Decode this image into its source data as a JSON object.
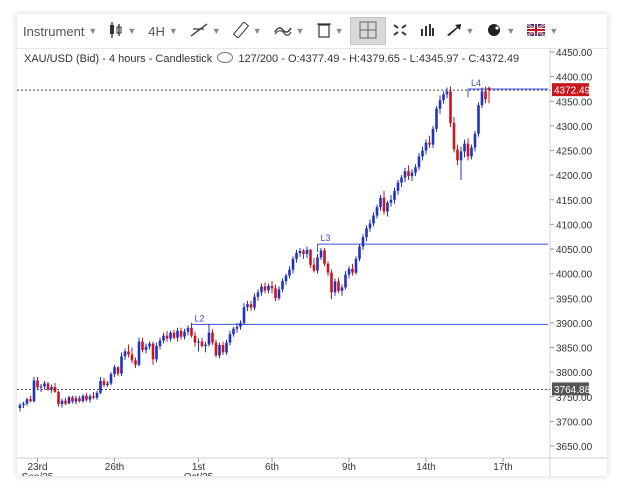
{
  "toolbar": {
    "instrument_label": "Instrument",
    "timeframe_label": "4H",
    "icons": [
      "candlestick-icon",
      "line-tool-icon",
      "ruler-icon",
      "indicator-icon",
      "trash-icon",
      "crosshair-icon",
      "fullscreen-icon",
      "volume-bars-icon",
      "arrow-tool-icon",
      "color-palette-icon",
      "flag-uk-icon"
    ]
  },
  "info_bar": {
    "symbol": "XAU/USD (Bid) - 4 hours - Candlestick",
    "count": "127/200",
    "ohlc": "- O:4377.49 - H:4379.65 - L:4345.97 - C:4372.49"
  },
  "colors": {
    "up": "#2233bb",
    "down": "#c8161d",
    "level_line": "#3b4fd9",
    "price_label_bg": "#c8161d",
    "marker_label_bg": "#555555"
  },
  "chart_data": {
    "type": "candlestick",
    "ylim": [
      3630,
      4460
    ],
    "y_ticks": [
      "4450.00",
      "4400.00",
      "4350.00",
      "4300.00",
      "4250.00",
      "4200.00",
      "4150.00",
      "4100.00",
      "4050.00",
      "4000.00",
      "3950.00",
      "3900.00",
      "3850.00",
      "3800.00",
      "3750.00",
      "3700.00",
      "3650.00"
    ],
    "y_tick_values": [
      4450,
      4400,
      4350,
      4300,
      4250,
      4200,
      4150,
      4100,
      4050,
      4000,
      3950,
      3900,
      3850,
      3800,
      3750,
      3700,
      3650
    ],
    "x_ticks": [
      {
        "index": 5,
        "line1": "23rd",
        "line2": "Sep/25"
      },
      {
        "index": 27,
        "line1": "26th",
        "line2": ""
      },
      {
        "index": 51,
        "line1": "1st",
        "line2": "Oct/25"
      },
      {
        "index": 72,
        "line1": "6th",
        "line2": ""
      },
      {
        "index": 94,
        "line1": "9th",
        "line2": ""
      },
      {
        "index": 116,
        "line1": "14th",
        "line2": ""
      },
      {
        "index": 138,
        "line1": "17th",
        "line2": ""
      }
    ],
    "current_price": 4372.49,
    "current_price_label": "4372.49",
    "marker_price": 3764.88,
    "marker_price_label": "3764.88",
    "levels": [
      {
        "label": "L2",
        "price": 3897,
        "start_index": 49
      },
      {
        "label": "L3",
        "price": 4060,
        "start_index": 85
      },
      {
        "label": "L4",
        "price": 4375,
        "start_index": 128
      }
    ],
    "ohlc": [
      [
        3727,
        3737,
        3720,
        3733
      ],
      [
        3733,
        3740,
        3727,
        3736
      ],
      [
        3736,
        3748,
        3732,
        3745
      ],
      [
        3745,
        3752,
        3738,
        3741
      ],
      [
        3741,
        3790,
        3738,
        3783
      ],
      [
        3783,
        3790,
        3766,
        3769
      ],
      [
        3769,
        3776,
        3760,
        3771
      ],
      [
        3771,
        3782,
        3765,
        3777
      ],
      [
        3777,
        3780,
        3762,
        3765
      ],
      [
        3765,
        3775,
        3758,
        3770
      ],
      [
        3770,
        3778,
        3758,
        3760
      ],
      [
        3760,
        3762,
        3730,
        3735
      ],
      [
        3735,
        3746,
        3728,
        3742
      ],
      [
        3742,
        3748,
        3733,
        3736
      ],
      [
        3736,
        3752,
        3735,
        3749
      ],
      [
        3749,
        3752,
        3736,
        3740
      ],
      [
        3740,
        3752,
        3735,
        3747
      ],
      [
        3747,
        3752,
        3738,
        3741
      ],
      [
        3741,
        3755,
        3738,
        3752
      ],
      [
        3752,
        3758,
        3740,
        3744
      ],
      [
        3744,
        3755,
        3738,
        3751
      ],
      [
        3751,
        3760,
        3745,
        3748
      ],
      [
        3748,
        3762,
        3744,
        3758
      ],
      [
        3758,
        3790,
        3755,
        3782
      ],
      [
        3782,
        3788,
        3770,
        3774
      ],
      [
        3774,
        3782,
        3770,
        3777
      ],
      [
        3777,
        3800,
        3773,
        3796
      ],
      [
        3796,
        3815,
        3790,
        3810
      ],
      [
        3810,
        3812,
        3792,
        3797
      ],
      [
        3797,
        3840,
        3792,
        3832
      ],
      [
        3832,
        3848,
        3825,
        3842
      ],
      [
        3842,
        3856,
        3830,
        3836
      ],
      [
        3836,
        3850,
        3818,
        3824
      ],
      [
        3824,
        3830,
        3808,
        3815
      ],
      [
        3815,
        3870,
        3812,
        3862
      ],
      [
        3862,
        3870,
        3840,
        3845
      ],
      [
        3845,
        3858,
        3838,
        3852
      ],
      [
        3852,
        3862,
        3846,
        3858
      ],
      [
        3858,
        3862,
        3815,
        3826
      ],
      [
        3826,
        3860,
        3820,
        3853
      ],
      [
        3853,
        3870,
        3846,
        3864
      ],
      [
        3864,
        3880,
        3858,
        3874
      ],
      [
        3874,
        3884,
        3862,
        3868
      ],
      [
        3868,
        3884,
        3862,
        3880
      ],
      [
        3880,
        3886,
        3866,
        3870
      ],
      [
        3870,
        3890,
        3862,
        3884
      ],
      [
        3884,
        3890,
        3866,
        3872
      ],
      [
        3872,
        3888,
        3866,
        3882
      ],
      [
        3882,
        3895,
        3875,
        3890
      ],
      [
        3890,
        3900,
        3870,
        3874
      ],
      [
        3874,
        3882,
        3852,
        3860
      ],
      [
        3860,
        3868,
        3842,
        3862
      ],
      [
        3862,
        3870,
        3850,
        3853
      ],
      [
        3853,
        3862,
        3840,
        3856
      ],
      [
        3856,
        3898,
        3852,
        3880
      ],
      [
        3880,
        3887,
        3855,
        3860
      ],
      [
        3860,
        3866,
        3830,
        3834
      ],
      [
        3834,
        3860,
        3828,
        3855
      ],
      [
        3855,
        3862,
        3835,
        3840
      ],
      [
        3840,
        3866,
        3835,
        3860
      ],
      [
        3860,
        3884,
        3854,
        3877
      ],
      [
        3877,
        3892,
        3872,
        3888
      ],
      [
        3888,
        3900,
        3880,
        3892
      ],
      [
        3892,
        3905,
        3886,
        3900
      ],
      [
        3900,
        3940,
        3896,
        3932
      ],
      [
        3932,
        3945,
        3924,
        3938
      ],
      [
        3938,
        3945,
        3925,
        3931
      ],
      [
        3931,
        3960,
        3926,
        3953
      ],
      [
        3953,
        3968,
        3945,
        3962
      ],
      [
        3962,
        3980,
        3955,
        3974
      ],
      [
        3974,
        3982,
        3960,
        3966
      ],
      [
        3966,
        3980,
        3960,
        3975
      ],
      [
        3975,
        3985,
        3960,
        3970
      ],
      [
        3970,
        3978,
        3944,
        3950
      ],
      [
        3950,
        3974,
        3946,
        3968
      ],
      [
        3968,
        3990,
        3962,
        3985
      ],
      [
        3985,
        4000,
        3978,
        3996
      ],
      [
        3996,
        4015,
        3990,
        4008
      ],
      [
        4008,
        4035,
        4000,
        4030
      ],
      [
        4030,
        4048,
        4022,
        4042
      ],
      [
        4042,
        4052,
        4034,
        4046
      ],
      [
        4046,
        4050,
        4030,
        4040
      ],
      [
        4040,
        4055,
        4032,
        4048
      ],
      [
        4048,
        4050,
        4012,
        4018
      ],
      [
        4018,
        4032,
        4002,
        4006
      ],
      [
        4006,
        4040,
        4000,
        4033
      ],
      [
        4033,
        4052,
        4028,
        4047
      ],
      [
        4047,
        4052,
        4015,
        4020
      ],
      [
        4020,
        4025,
        3995,
        4002
      ],
      [
        4002,
        4008,
        3948,
        3962
      ],
      [
        3962,
        3990,
        3955,
        3984
      ],
      [
        3984,
        3992,
        3960,
        3965
      ],
      [
        3965,
        3978,
        3955,
        3972
      ],
      [
        3972,
        4005,
        3968,
        3998
      ],
      [
        3998,
        4015,
        3990,
        4010
      ],
      [
        4010,
        4020,
        3996,
        4002
      ],
      [
        4002,
        4035,
        3998,
        4030
      ],
      [
        4030,
        4060,
        4025,
        4055
      ],
      [
        4055,
        4080,
        4048,
        4074
      ],
      [
        4074,
        4098,
        4066,
        4092
      ],
      [
        4092,
        4110,
        4085,
        4102
      ],
      [
        4102,
        4125,
        4096,
        4118
      ],
      [
        4118,
        4140,
        4112,
        4135
      ],
      [
        4135,
        4160,
        4128,
        4154
      ],
      [
        4154,
        4168,
        4120,
        4126
      ],
      [
        4126,
        4148,
        4116,
        4144
      ],
      [
        4144,
        4160,
        4136,
        4150
      ],
      [
        4150,
        4175,
        4142,
        4168
      ],
      [
        4168,
        4190,
        4160,
        4185
      ],
      [
        4185,
        4200,
        4176,
        4195
      ],
      [
        4195,
        4215,
        4186,
        4208
      ],
      [
        4208,
        4220,
        4190,
        4198
      ],
      [
        4198,
        4212,
        4188,
        4205
      ],
      [
        4205,
        4222,
        4198,
        4216
      ],
      [
        4216,
        4245,
        4210,
        4238
      ],
      [
        4238,
        4258,
        4230,
        4250
      ],
      [
        4250,
        4272,
        4242,
        4266
      ],
      [
        4266,
        4280,
        4255,
        4262
      ],
      [
        4262,
        4300,
        4255,
        4294
      ],
      [
        4294,
        4340,
        4288,
        4335
      ],
      [
        4335,
        4362,
        4325,
        4352
      ],
      [
        4352,
        4370,
        4345,
        4364
      ],
      [
        4364,
        4378,
        4356,
        4370
      ],
      [
        4370,
        4380,
        4298,
        4306
      ],
      [
        4306,
        4318,
        4246,
        4252
      ],
      [
        4252,
        4262,
        4220,
        4230
      ],
      [
        4230,
        4258,
        4190,
        4248
      ],
      [
        4248,
        4272,
        4236,
        4264
      ],
      [
        4264,
        4275,
        4230,
        4238
      ],
      [
        4238,
        4262,
        4232,
        4256
      ],
      [
        4256,
        4290,
        4248,
        4284
      ],
      [
        4284,
        4348,
        4278,
        4342
      ],
      [
        4342,
        4378,
        4336,
        4370
      ],
      [
        4370,
        4380,
        4346,
        4354
      ],
      [
        4377.49,
        4379.65,
        4345.97,
        4372.49
      ]
    ]
  }
}
